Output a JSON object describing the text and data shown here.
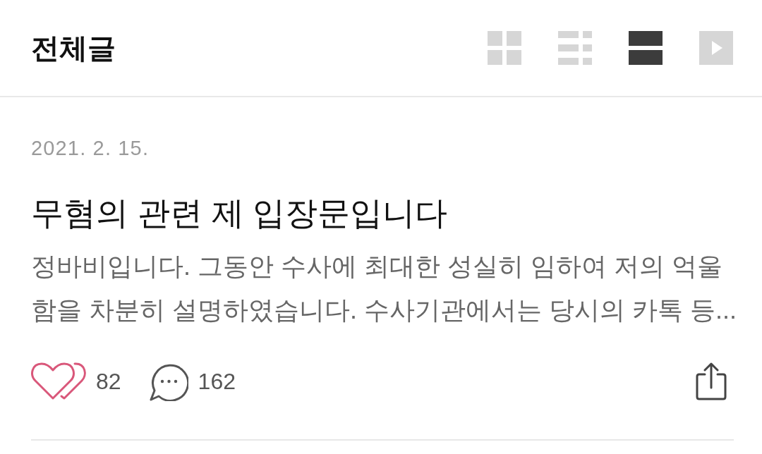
{
  "header": {
    "title": "전체글",
    "view_modes": [
      {
        "kind": "grid",
        "selected": false
      },
      {
        "kind": "list",
        "selected": false
      },
      {
        "kind": "card",
        "selected": true
      },
      {
        "kind": "slideshow",
        "selected": false
      }
    ]
  },
  "post": {
    "date": "2021. 2. 15.",
    "title": "무혐의 관련 제 입장문입니다",
    "excerpt": "정바비입니다. 그동안 수사에 최대한 성실히 임하여 저의 억울함을 차분히 설명하였습니다. 수사기관에서는 당시의 카톡 등...",
    "likes": "82",
    "comments": "162"
  }
}
